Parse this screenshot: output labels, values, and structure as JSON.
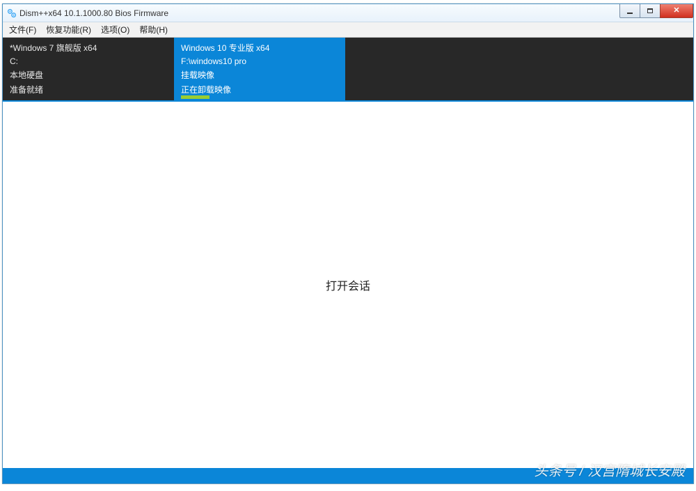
{
  "title": "Dism++x64 10.1.1000.80 Bios Firmware",
  "menu": {
    "file": "文件(F)",
    "recovery": "恢复功能(R)",
    "options": "选项(O)",
    "help": "帮助(H)"
  },
  "images": [
    {
      "name": "*Windows 7 旗舰版 x64",
      "path": "C:",
      "disk": "本地硬盘",
      "status": "准备就绪"
    },
    {
      "name": "Windows 10 专业版 x64",
      "path": "F:\\windows10 pro",
      "disk": "挂载映像",
      "status": "正在卸载映像"
    }
  ],
  "content_prompt": "打开会话",
  "watermark": "头条号 / 汉宫隋城长安殿"
}
